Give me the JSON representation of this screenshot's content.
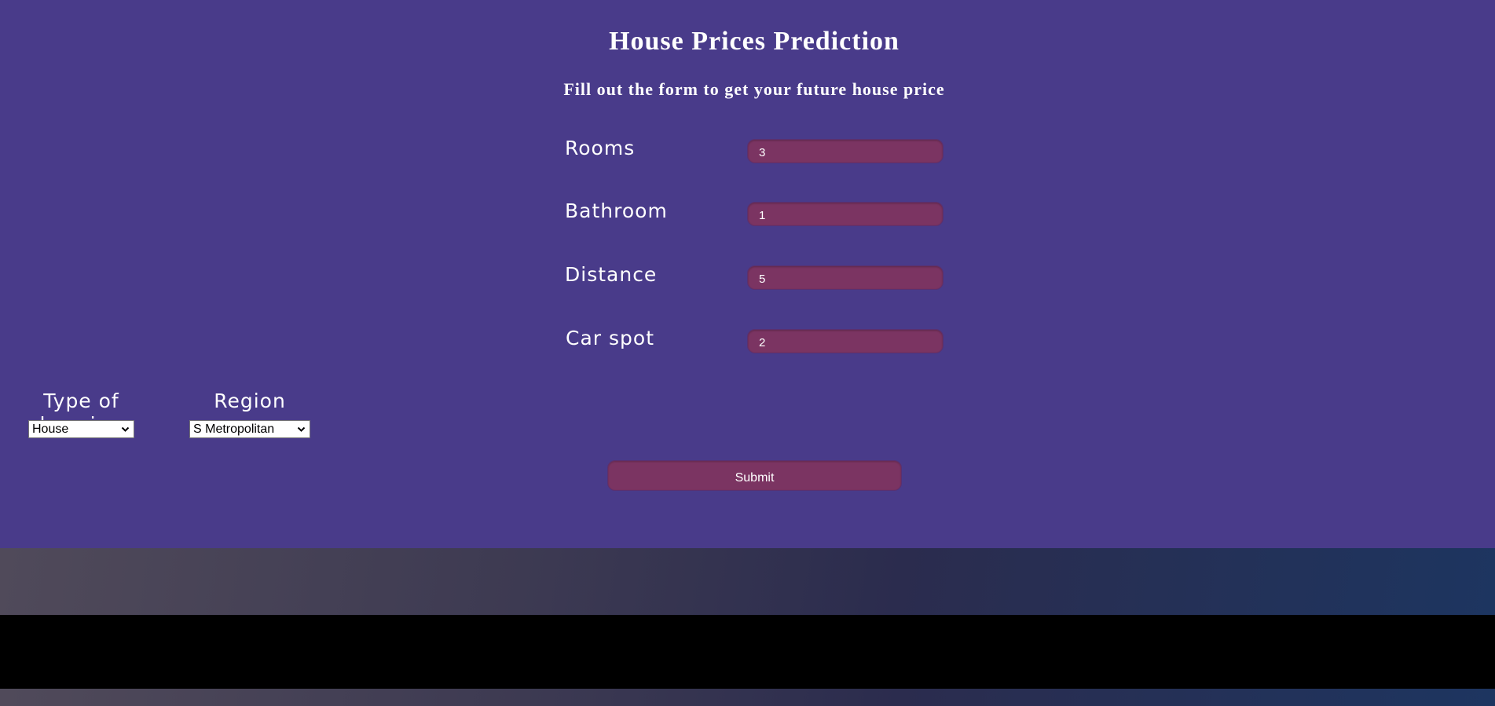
{
  "header": {
    "title": "House Prices Prediction",
    "subtitle": "Fill out the form to get your future house price"
  },
  "form": {
    "fields": [
      {
        "label": "Rooms",
        "value": "3"
      },
      {
        "label": "Bathroom",
        "value": "1"
      },
      {
        "label": "Distance",
        "value": "5"
      },
      {
        "label": "Car spot",
        "value": "2"
      }
    ],
    "selects": [
      {
        "label": "Type of housing",
        "selected": "House"
      },
      {
        "label": "Region",
        "selected": "S Metropolitan"
      }
    ],
    "submit_label": "Submit"
  },
  "colors": {
    "background": "#493b8a",
    "input_fill": "#7b3462",
    "text": "#ffffff"
  }
}
